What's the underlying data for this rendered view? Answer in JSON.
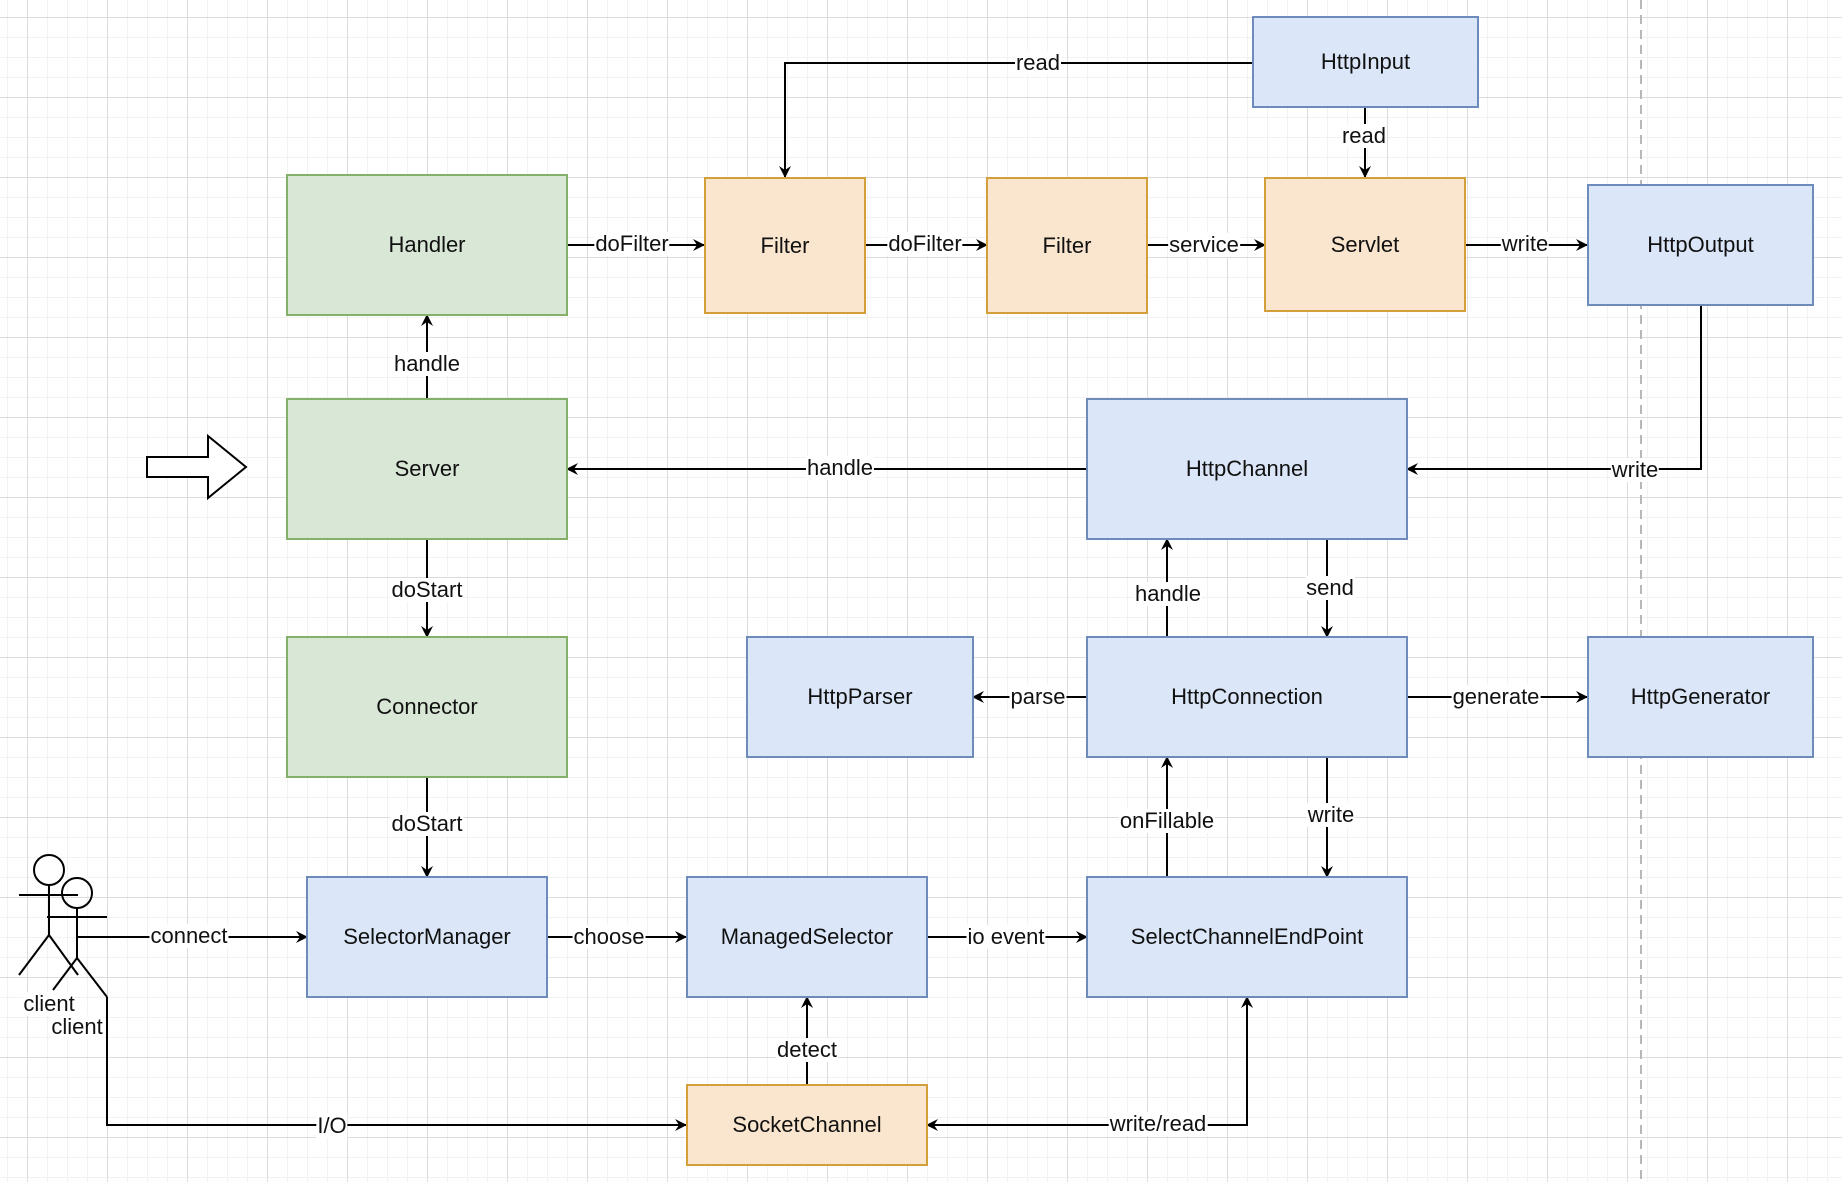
{
  "diagram": {
    "nodes": {
      "handler": {
        "label": "Handler",
        "group": "green"
      },
      "server": {
        "label": "Server",
        "group": "green"
      },
      "connector": {
        "label": "Connector",
        "group": "green"
      },
      "filter1": {
        "label": "Filter",
        "group": "orange"
      },
      "filter2": {
        "label": "Filter",
        "group": "orange"
      },
      "servlet": {
        "label": "Servlet",
        "group": "orange"
      },
      "socket_channel": {
        "label": "SocketChannel",
        "group": "orange"
      },
      "http_input": {
        "label": "HttpInput",
        "group": "blue"
      },
      "http_output": {
        "label": "HttpOutput",
        "group": "blue"
      },
      "http_channel": {
        "label": "HttpChannel",
        "group": "blue"
      },
      "http_parser": {
        "label": "HttpParser",
        "group": "blue"
      },
      "http_connection": {
        "label": "HttpConnection",
        "group": "blue"
      },
      "http_generator": {
        "label": "HttpGenerator",
        "group": "blue"
      },
      "selector_manager": {
        "label": "SelectorManager",
        "group": "blue"
      },
      "managed_selector": {
        "label": "ManagedSelector",
        "group": "blue"
      },
      "select_channel_end_point": {
        "label": "SelectChannelEndPoint",
        "group": "blue"
      }
    },
    "actors": [
      {
        "label": "client"
      },
      {
        "label": "client"
      }
    ],
    "edges": [
      {
        "from": "http_input",
        "to": "filter1",
        "label": "read"
      },
      {
        "from": "http_input",
        "to": "servlet",
        "label": "read"
      },
      {
        "from": "handler",
        "to": "filter1",
        "label": "doFilter"
      },
      {
        "from": "filter1",
        "to": "filter2",
        "label": "doFilter"
      },
      {
        "from": "filter2",
        "to": "servlet",
        "label": "service"
      },
      {
        "from": "servlet",
        "to": "http_output",
        "label": "write"
      },
      {
        "from": "server",
        "to": "handler",
        "label": "handle"
      },
      {
        "from": "http_channel",
        "to": "server",
        "label": "handle"
      },
      {
        "from": "http_output",
        "to": "http_channel",
        "label": "write"
      },
      {
        "from": "server",
        "to": "connector",
        "label": "doStart"
      },
      {
        "from": "http_connection",
        "to": "http_channel",
        "label": "handle"
      },
      {
        "from": "http_channel",
        "to": "http_connection",
        "label": "send"
      },
      {
        "from": "http_connection",
        "to": "http_parser",
        "label": "parse"
      },
      {
        "from": "http_connection",
        "to": "http_generator",
        "label": "generate"
      },
      {
        "from": "connector",
        "to": "selector_manager",
        "label": "doStart"
      },
      {
        "from": "select_channel_end_point",
        "to": "http_connection",
        "label": "onFillable"
      },
      {
        "from": "http_connection",
        "to": "select_channel_end_point",
        "label": "write"
      },
      {
        "from": "client",
        "to": "selector_manager",
        "label": "connect"
      },
      {
        "from": "selector_manager",
        "to": "managed_selector",
        "label": "choose"
      },
      {
        "from": "managed_selector",
        "to": "select_channel_end_point",
        "label": "io event"
      },
      {
        "from": "socket_channel",
        "to": "managed_selector",
        "label": "detect"
      },
      {
        "from": "client",
        "to": "socket_channel",
        "label": "I/O"
      },
      {
        "from": "select_channel_end_point",
        "to": "socket_channel",
        "label": "write/read"
      }
    ],
    "colors": {
      "green_fill": "#d9e7d6",
      "green_stroke": "#84b06a",
      "orange_fill": "#fae6cf",
      "orange_stroke": "#d39f3b",
      "blue_fill": "#dbe7f8",
      "blue_stroke": "#6e8cbb",
      "edge": "#000000"
    }
  }
}
